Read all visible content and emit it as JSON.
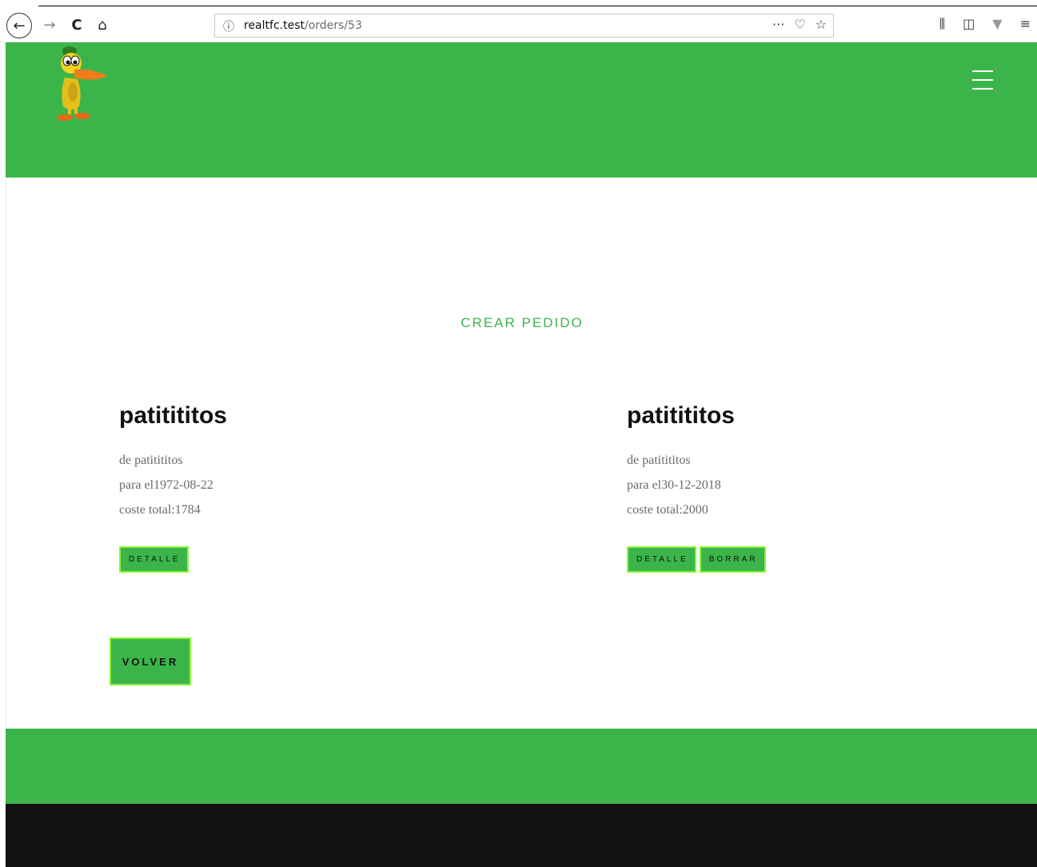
{
  "browser": {
    "back_glyph": "←",
    "forward_glyph": "→",
    "reload_glyph": "C",
    "home_glyph": "⌂",
    "info_glyph": "ⓘ",
    "url_host": "realtfc.test",
    "url_path": "/orders/53",
    "more_glyph": "···",
    "pocket_glyph": "♡",
    "star_glyph": "☆",
    "library_glyph": "⫼",
    "sidebar_glyph": "◫",
    "extension_glyph": "▼",
    "menu_glyph": "≡"
  },
  "colors": {
    "brand_green": "#3bb54a",
    "button_border": "#8cf53a",
    "footer_dark": "#111111"
  },
  "main": {
    "create_link": "CREAR PEDIDO",
    "orders": [
      {
        "title": "patitititos",
        "from_line": "de patitititos",
        "date_line": "para el1972-08-22",
        "cost_line": "coste total:1784",
        "detail_label": "DETALLE"
      },
      {
        "title": "patitititos",
        "from_line": "de patitititos",
        "date_line": "para el30-12-2018",
        "cost_line": "coste total:2000",
        "detail_label": "DETALLE",
        "delete_label": "BORRAR"
      }
    ],
    "back_label": "VOLVER"
  }
}
